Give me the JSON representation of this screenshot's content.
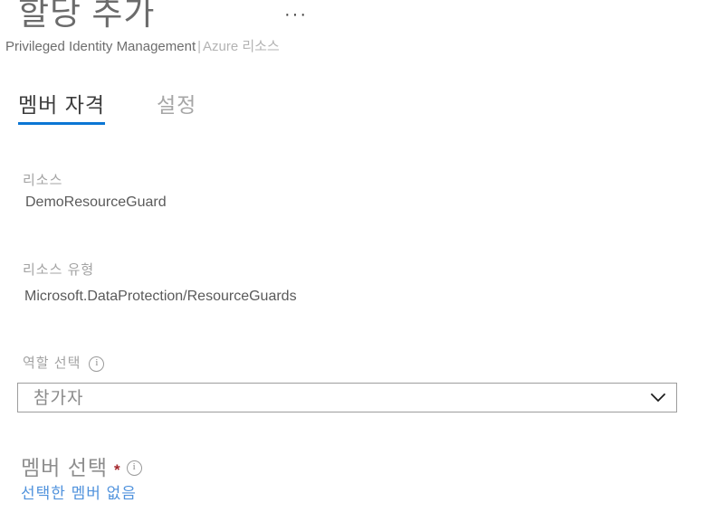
{
  "header": {
    "title": "할당 추가",
    "overflow_menu": "···",
    "subtitle_main": "Privileged Identity Management",
    "subtitle_separator": "|",
    "subtitle_context": "Azure 리소스"
  },
  "tabs": [
    {
      "label": "멤버 자격",
      "active": true
    },
    {
      "label": "설정",
      "active": false
    }
  ],
  "fields": {
    "resource": {
      "label": "리소스",
      "value": "DemoResourceGuard"
    },
    "resource_type": {
      "label": "리소스 유형",
      "value": "Microsoft.DataProtection/ResourceGuards"
    },
    "role": {
      "label": "역할 선택",
      "info_icon": "info-icon",
      "selected": "참가자",
      "chevron_icon": "chevron-down-icon"
    },
    "member": {
      "label": "멤버 선택",
      "required_marker": "*",
      "info_icon": "info-icon",
      "link_text": "선택한 멤버 없음"
    }
  },
  "colors": {
    "accent": "#0b76d4",
    "link": "#5193dd",
    "required": "#a4262c",
    "label_gray": "#a3a3a3",
    "value_gray": "#5a5a5a",
    "title_gray": "#6b6b6b",
    "background": "#ffffff"
  }
}
